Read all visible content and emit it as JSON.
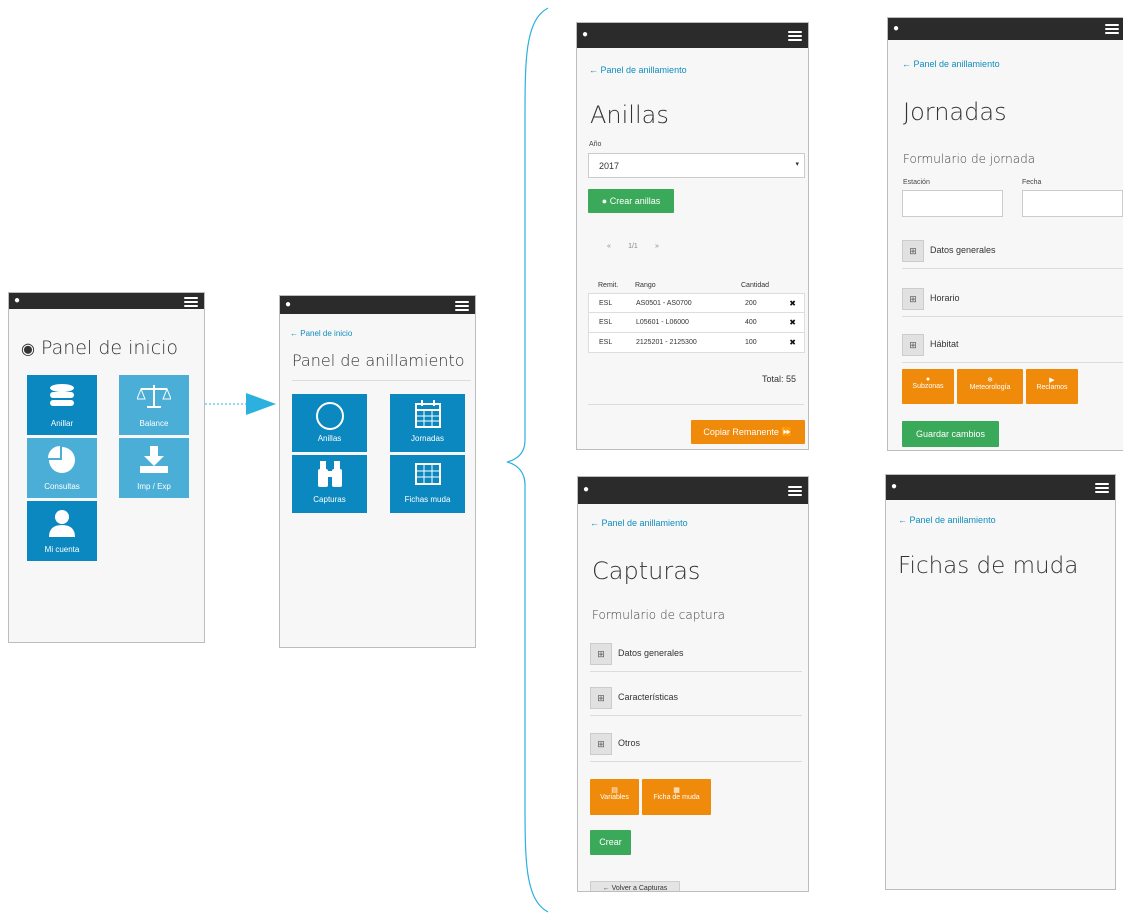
{
  "colors": {
    "primary": "#0b88bf",
    "primary_light": "#4aaed6",
    "orange": "#ef8a0b",
    "green": "#3aa95a",
    "topbar": "#2b2b2b",
    "link": "#0f8dbf"
  },
  "screen_home": {
    "title": "Panel de inicio",
    "tiles": [
      {
        "label": "Anillar",
        "icon": "database-icon"
      },
      {
        "label": "Balance",
        "icon": "scale-icon"
      },
      {
        "label": "Consultas",
        "icon": "pie-chart-icon"
      },
      {
        "label": "Imp / Exp",
        "icon": "download-icon"
      },
      {
        "label": "Mi cuenta",
        "icon": "user-icon"
      }
    ]
  },
  "screen_ringing": {
    "back": "Panel de inicio",
    "title": "Panel de anillamiento",
    "tiles": [
      {
        "label": "Anillas",
        "icon": "circle-icon"
      },
      {
        "label": "Jornadas",
        "icon": "calendar-icon"
      },
      {
        "label": "Capturas",
        "icon": "binoculars-icon"
      },
      {
        "label": "Fichas muda",
        "icon": "grid-icon"
      }
    ]
  },
  "screen_anillas": {
    "back": "Panel de anillamiento",
    "title": "Anillas",
    "year_label": "Año",
    "year_value": "2017",
    "create_button": "Crear anillas",
    "pagination": {
      "prev": "«",
      "page": "1/1",
      "next": "»"
    },
    "columns": [
      "Remit.",
      "Rango",
      "Cantidad"
    ],
    "rows": [
      {
        "remit": "ESL",
        "range": "AS0501 - AS0700",
        "qty": "200"
      },
      {
        "remit": "ESL",
        "range": "L05601 - L06000",
        "qty": "400"
      },
      {
        "remit": "ESL",
        "range": "2125201 - 2125300",
        "qty": "100"
      }
    ],
    "total": "Total: 55",
    "copy_button": "Copiar Remanente"
  },
  "screen_jornadas": {
    "back": "Panel de anillamiento",
    "title": "Jornadas",
    "form_title": "Formulario de jornada",
    "station_label": "Estación",
    "date_label": "Fecha",
    "sections": [
      "Datos generales",
      "Horario",
      "Hábitat"
    ],
    "actions": [
      {
        "label": "Subzonas",
        "icon": "pin-icon"
      },
      {
        "label": "Meteorología",
        "icon": "snowflake-icon"
      },
      {
        "label": "Reclamos",
        "icon": "speaker-icon"
      }
    ],
    "save_button": "Guardar cambios"
  },
  "screen_capturas": {
    "back": "Panel de anillamiento",
    "title": "Capturas",
    "form_title": "Formulario de captura",
    "sections": [
      "Datos generales",
      "Características",
      "Otros"
    ],
    "actions": [
      {
        "label": "Variables",
        "icon": "list-icon"
      },
      {
        "label": "Ficha de muda",
        "icon": "grid-icon"
      }
    ],
    "create_button": "Crear",
    "back_button": "Volver a Capturas"
  },
  "screen_fichas": {
    "back": "Panel de anillamiento",
    "title": "Fichas de muda"
  }
}
